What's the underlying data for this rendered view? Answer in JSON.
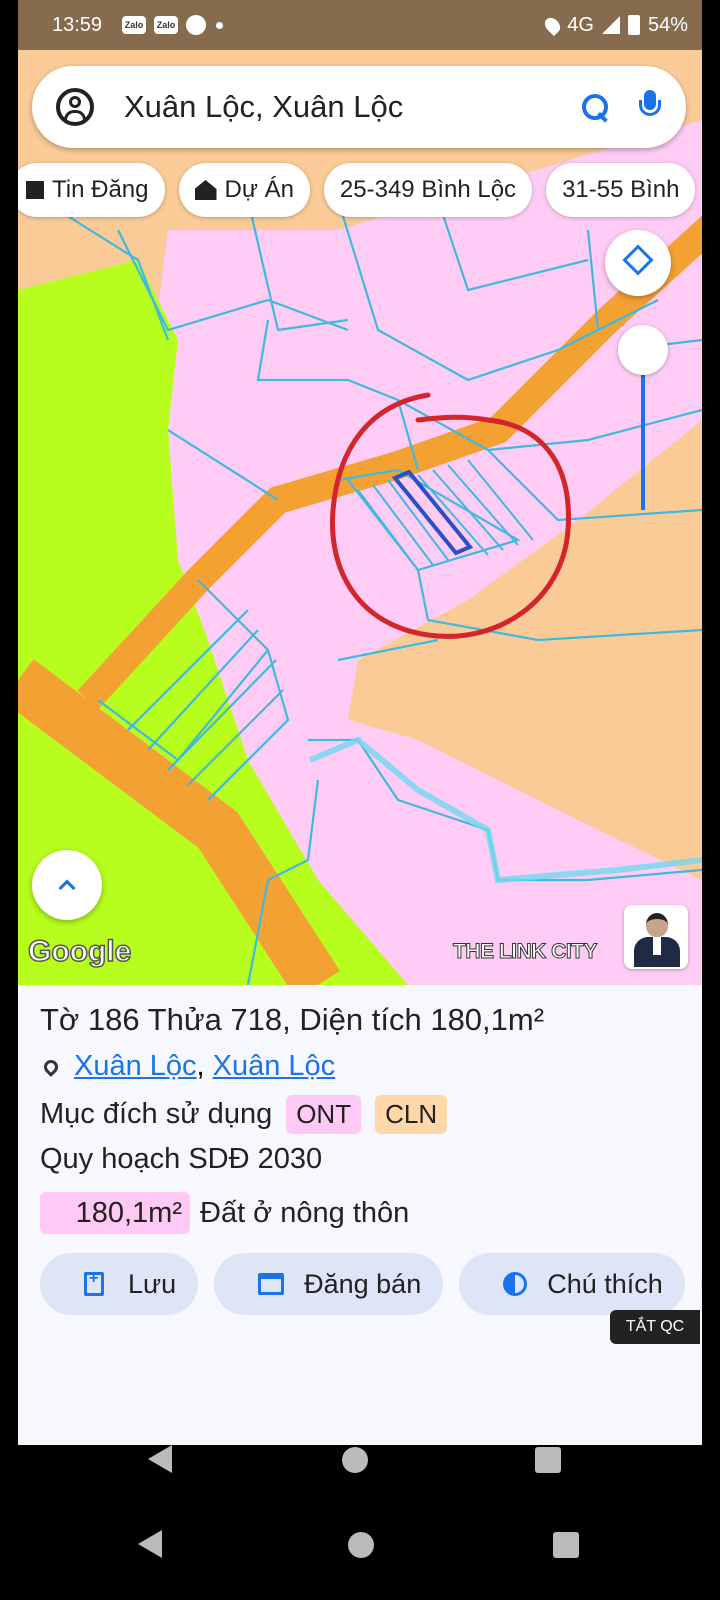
{
  "status_bar": {
    "time": "13:59",
    "app_icons": [
      "Zalo",
      "Zalo"
    ],
    "network": "4G",
    "battery": "54%"
  },
  "search": {
    "query": "Xuân Lộc, Xuân Lộc"
  },
  "chips": [
    {
      "label": "Tin Đăng",
      "icon": "list-icon"
    },
    {
      "label": "Dự Án",
      "icon": "house-icon"
    },
    {
      "label": "25-349 Bình Lộc"
    },
    {
      "label": "31-55 Bình"
    }
  ],
  "map": {
    "attribution": "Google",
    "watermark": "THE LINK CITY",
    "colors": {
      "residential": "#ffccf5",
      "perennial": "#fbcb97",
      "forest": "#b7fd1d",
      "road": "#f4a133",
      "parcel_lines": "#3fb9dd",
      "circle": "#d3252c",
      "selected": "#2a50c7"
    }
  },
  "parcel": {
    "title": "Tờ 186 Thửa 718, Diện tích 180,1m²",
    "location_links": [
      "Xuân Lộc",
      "Xuân Lộc"
    ],
    "location_separator": ",",
    "purpose_label": "Mục đích sử dụng",
    "purpose_tags": [
      "ONT",
      "CLN"
    ],
    "plan": "Quy hoạch SDĐ 2030",
    "area_badge": "180,1m²",
    "area_desc": "Đất ở nông thôn"
  },
  "actions": [
    {
      "label": "Lưu",
      "icon": "add-doc-icon"
    },
    {
      "label": "Đăng bán",
      "icon": "calendar-icon"
    },
    {
      "label": "Chú thích",
      "icon": "contrast-icon"
    }
  ],
  "ad_label": "TẮT QC"
}
